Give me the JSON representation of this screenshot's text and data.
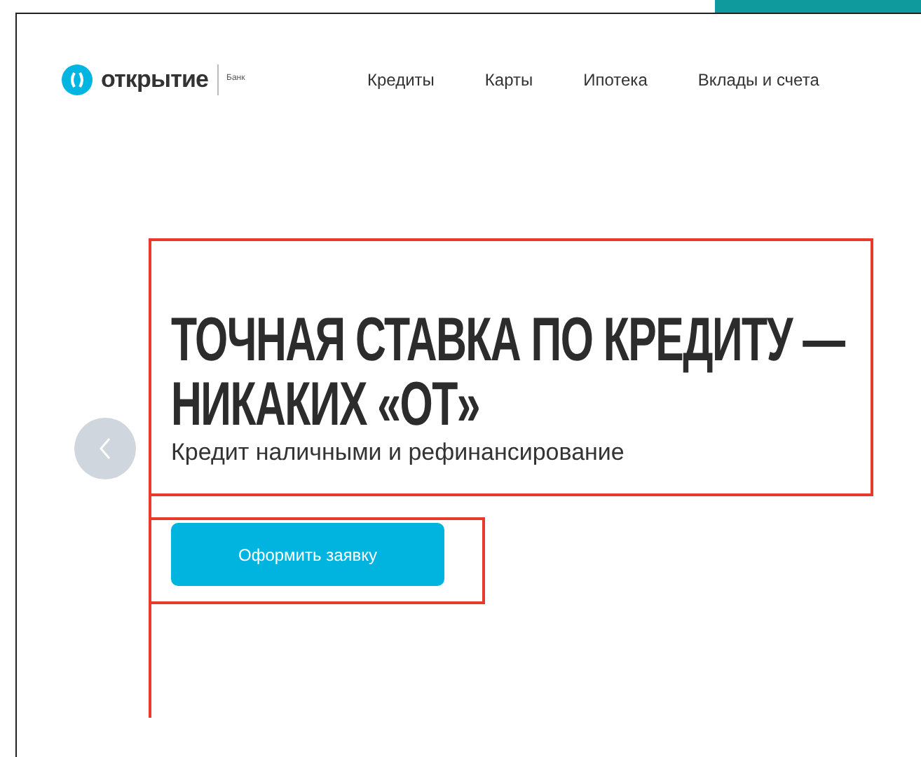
{
  "logo": {
    "name": "открытие",
    "suffix": "Банк"
  },
  "nav": [
    {
      "label": "Кредиты"
    },
    {
      "label": "Карты"
    },
    {
      "label": "Ипотека"
    },
    {
      "label": "Вклады и счета"
    }
  ],
  "hero": {
    "title_lines": [
      "ТОЧНАЯ СТАВКА ПО КРЕДИТУ —",
      "НИКАКИХ «ОТ»"
    ],
    "subtitle": "Кредит наличными и рефинансирование",
    "button": "Оформить заявку"
  }
}
